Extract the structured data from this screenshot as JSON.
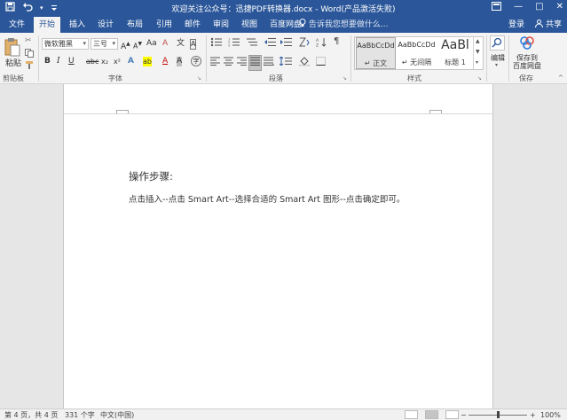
{
  "window": {
    "title": "欢迎关注公众号：迅捷PDF转换器.docx - Word(产品激活失败)",
    "qat": {
      "save_icon": "save-icon",
      "undo_icon": "undo-icon",
      "customize_icon": "customize-qat-icon"
    },
    "controls": {
      "ribbon_display_icon": "ribbon-display-icon",
      "minimize": "—",
      "restore": "□",
      "close": "✕"
    }
  },
  "tabs": [
    {
      "label": "文件"
    },
    {
      "label": "开始"
    },
    {
      "label": "插入"
    },
    {
      "label": "设计"
    },
    {
      "label": "布局"
    },
    {
      "label": "引用"
    },
    {
      "label": "邮件"
    },
    {
      "label": "审阅"
    },
    {
      "label": "视图"
    },
    {
      "label": "百度网盘"
    }
  ],
  "tell_me": "告诉我您想要做什么...",
  "account": {
    "login": "登录",
    "share": "共享"
  },
  "ribbon": {
    "clipboard": {
      "paste": "粘贴",
      "group": "剪贴板"
    },
    "font": {
      "name": "微软雅黑",
      "size": "三号",
      "bold": "B",
      "italic": "I",
      "underline": "U",
      "strike": "abc",
      "subscript": "x₂",
      "superscript": "x²",
      "grow": "A",
      "shrink": "A",
      "case": "Aa",
      "clear": "A",
      "effects": "A",
      "highlight": "ab",
      "color": "A",
      "shade": "A",
      "border": "A",
      "phonetic": "文",
      "enclose": "字",
      "group": "字体"
    },
    "paragraph": {
      "group": "段落"
    },
    "styles": {
      "items": [
        {
          "preview": "AaBbCcDd",
          "name": "↵ 正文"
        },
        {
          "preview": "AaBbCcDd",
          "name": "↵ 无间隔"
        },
        {
          "preview": "AaBl",
          "name": "标题 1"
        }
      ],
      "group": "样式"
    },
    "editing": {
      "label": "编辑"
    },
    "save": {
      "label1": "保存到",
      "label2": "百度网盘",
      "group": "保存"
    }
  },
  "document": {
    "heading": "操作步骤:",
    "paragraph": "点击插入--点击 Smart Art--选择合适的 Smart Art 图形--点击确定即可。"
  },
  "status": {
    "page": "第 4 页，共 4 页",
    "words": "331 个字",
    "lang": "中文(中国)",
    "zoom": "100%"
  },
  "colors": {
    "accent": "#2b579a",
    "ribbon": "#f3f3f3",
    "canvas": "#e6e6e6"
  }
}
